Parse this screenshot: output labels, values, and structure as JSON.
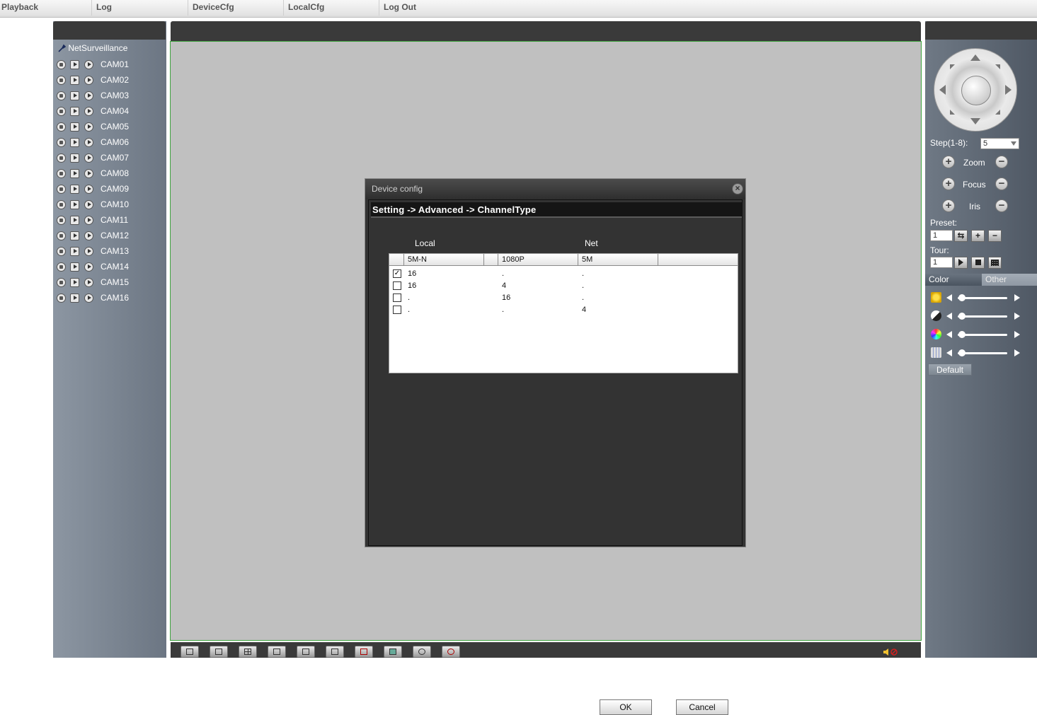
{
  "top_menu": {
    "playback": "Playback",
    "log": "Log",
    "device_cfg": "DeviceCfg",
    "local_cfg": "LocalCfg",
    "log_out": "Log Out"
  },
  "tree": {
    "root": "NetSurveillance",
    "cameras": [
      "CAM01",
      "CAM02",
      "CAM03",
      "CAM04",
      "CAM05",
      "CAM06",
      "CAM07",
      "CAM08",
      "CAM09",
      "CAM10",
      "CAM11",
      "CAM12",
      "CAM13",
      "CAM14",
      "CAM15",
      "CAM16"
    ]
  },
  "ptz": {
    "step_label": "Step(1-8):",
    "step_value": "5",
    "zoom_label": "Zoom",
    "focus_label": "Focus",
    "iris_label": "Iris",
    "preset_label": "Preset:",
    "preset_value": "1",
    "tour_label": "Tour:",
    "tour_value": "1"
  },
  "image_settings": {
    "tab_color": "Color",
    "tab_other": "Other",
    "default_button": "Default",
    "slider_levels": [
      0.0,
      0.0,
      0.0,
      0.0
    ]
  },
  "dialog": {
    "title": "Device config",
    "breadcrumb": "Setting -> Advanced -> ChannelType",
    "local_header": "Local",
    "net_header": "Net",
    "columns": [
      "5M-N",
      "1080P",
      "5M"
    ],
    "rows": [
      {
        "checked": true,
        "c1": "16",
        "c2": ".",
        "c3": "."
      },
      {
        "checked": false,
        "c1": "16",
        "c2": "4",
        "c3": "."
      },
      {
        "checked": false,
        "c1": ".",
        "c2": "16",
        "c3": "."
      },
      {
        "checked": false,
        "c1": ".",
        "c2": ".",
        "c3": "4"
      }
    ],
    "ok_button": "OK",
    "cancel_button": "Cancel"
  },
  "colors": {
    "video_border": "#3fa43f",
    "dialog_bg": "#333333",
    "panel_head": "#3a3a3a"
  }
}
